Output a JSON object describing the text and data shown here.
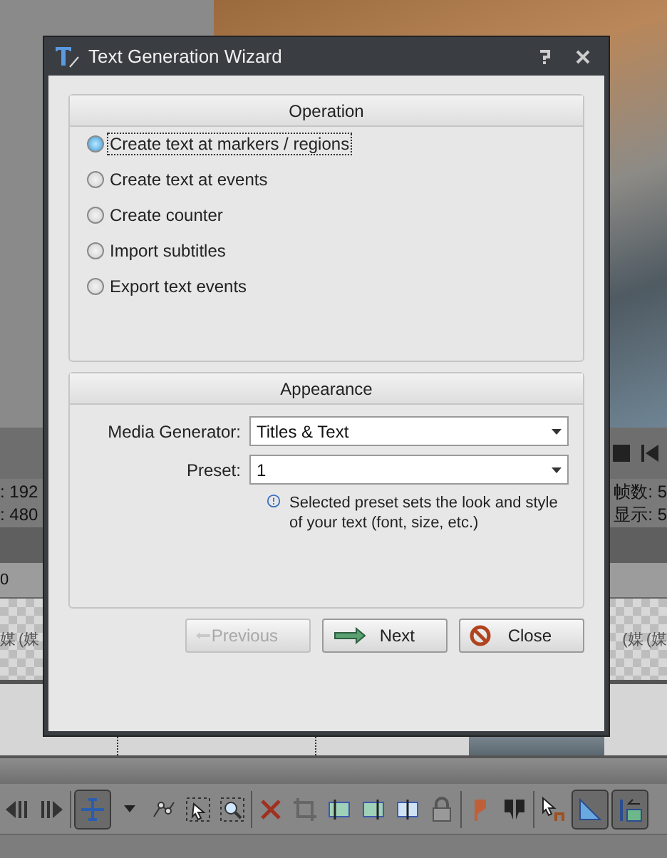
{
  "editor": {
    "status_left": [
      ": 192",
      ": 480"
    ],
    "status_right": [
      "帧数: 5",
      "显示: 5"
    ],
    "ruler_label": "0",
    "track_labels_left": [
      "媒",
      "(媒"
    ],
    "track_labels_right": [
      "(媒",
      "(媒"
    ],
    "toolbar": [
      {
        "kind": "prev",
        "selected": false
      },
      {
        "kind": "next",
        "selected": false
      },
      {
        "kind": "edit",
        "selected": true
      },
      {
        "kind": "caret",
        "selected": false
      },
      {
        "kind": "envelope",
        "selected": false
      },
      {
        "kind": "select",
        "selected": false
      },
      {
        "kind": "zoom",
        "selected": false
      },
      {
        "kind": "delete",
        "selected": false
      },
      {
        "kind": "crop",
        "selected": false
      },
      {
        "kind": "trimstart",
        "selected": false
      },
      {
        "kind": "trimend",
        "selected": false
      },
      {
        "kind": "split",
        "selected": false
      },
      {
        "kind": "lock",
        "selected": false
      },
      {
        "kind": "marker",
        "selected": false
      },
      {
        "kind": "region",
        "selected": false
      },
      {
        "kind": "pointer",
        "selected": false
      },
      {
        "kind": "snap",
        "selected": true
      },
      {
        "kind": "ripple",
        "selected": true
      }
    ]
  },
  "dialog": {
    "title": "Text Generation Wizard",
    "operation": {
      "heading": "Operation",
      "options": [
        {
          "label": "Create text at markers / regions",
          "selected": true
        },
        {
          "label": "Create text at events",
          "selected": false
        },
        {
          "label": "Create counter",
          "selected": false
        },
        {
          "label": "Import subtitles",
          "selected": false
        },
        {
          "label": "Export text events",
          "selected": false
        }
      ]
    },
    "appearance": {
      "heading": "Appearance",
      "fields": [
        {
          "label": "Media Generator:",
          "value": "Titles & Text"
        },
        {
          "label": "Preset:",
          "value": "1"
        }
      ],
      "note": "Selected preset sets the look and style of your text (font, size, etc.)"
    },
    "buttons": [
      {
        "kind": "previous",
        "label": "Previous",
        "disabled": true
      },
      {
        "kind": "next",
        "label": "Next",
        "disabled": false
      },
      {
        "kind": "close",
        "label": "Close",
        "disabled": false
      }
    ]
  }
}
